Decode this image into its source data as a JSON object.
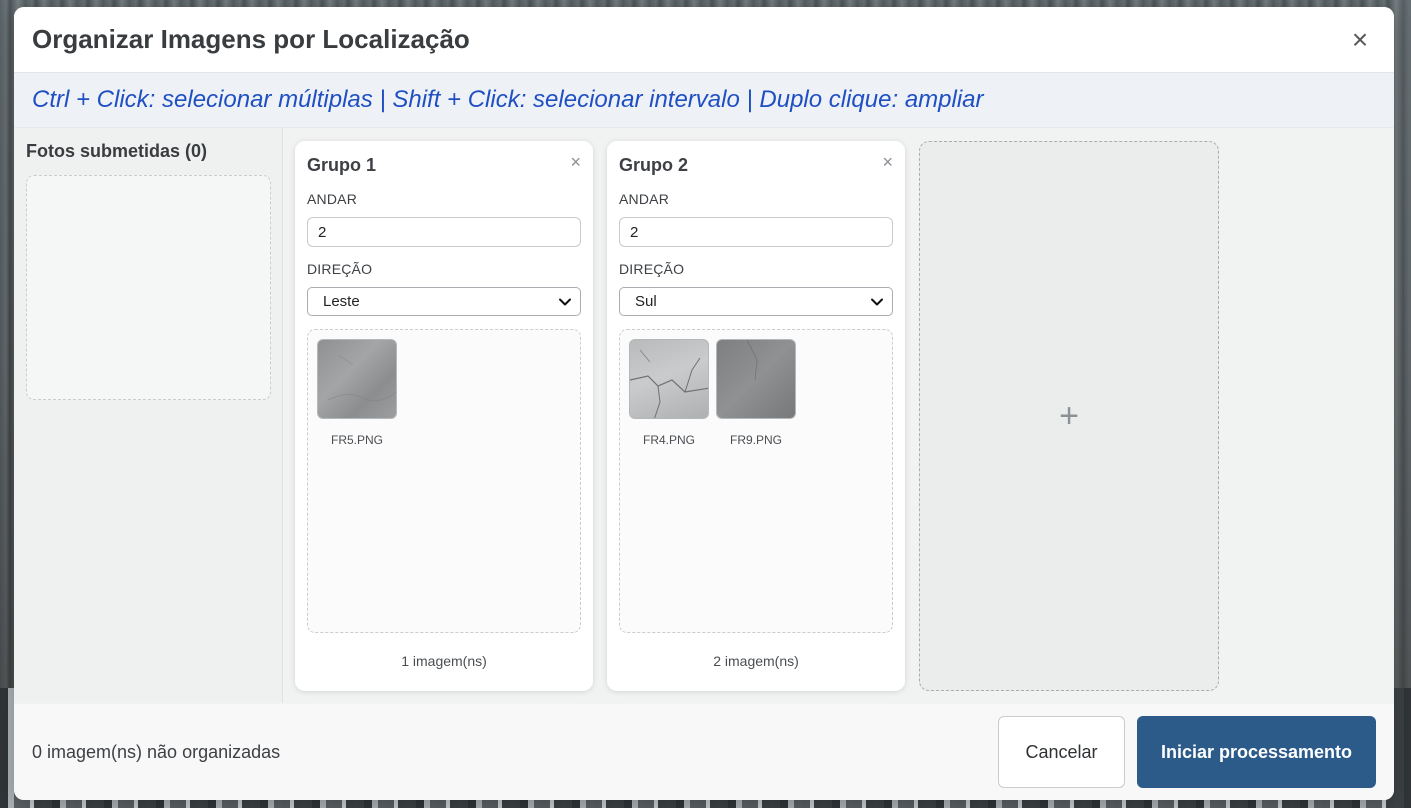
{
  "modal": {
    "title": "Organizar Imagens por Localização",
    "hint": "Ctrl + Click: selecionar múltiplas | Shift + Click: selecionar intervalo | Duplo clique: ampliar"
  },
  "sidebar": {
    "title": "Fotos submetidas (0)"
  },
  "groups": [
    {
      "title": "Grupo 1",
      "floor_label": "ANDAR",
      "floor_value": "2",
      "direction_label": "DIREÇÃO",
      "direction_value": "Leste",
      "images": [
        {
          "name": "FR5.PNG"
        }
      ],
      "count": "1 imagem(ns)"
    },
    {
      "title": "Grupo 2",
      "floor_label": "ANDAR",
      "floor_value": "2",
      "direction_label": "DIREÇÃO",
      "direction_value": "Sul",
      "images": [
        {
          "name": "FR4.PNG"
        },
        {
          "name": "FR9.PNG"
        }
      ],
      "count": "2 imagem(ns)"
    }
  ],
  "add_group": {
    "icon": "plus-icon",
    "symbol": "+"
  },
  "footer": {
    "status": "0 imagem(ns) não organizadas",
    "cancel_label": "Cancelar",
    "primary_label": "Iniciar processamento"
  },
  "icons": {
    "close": "×",
    "group_close": "×"
  },
  "colors": {
    "accent": "#2c5b8a",
    "hint": "#1f4fc2"
  }
}
